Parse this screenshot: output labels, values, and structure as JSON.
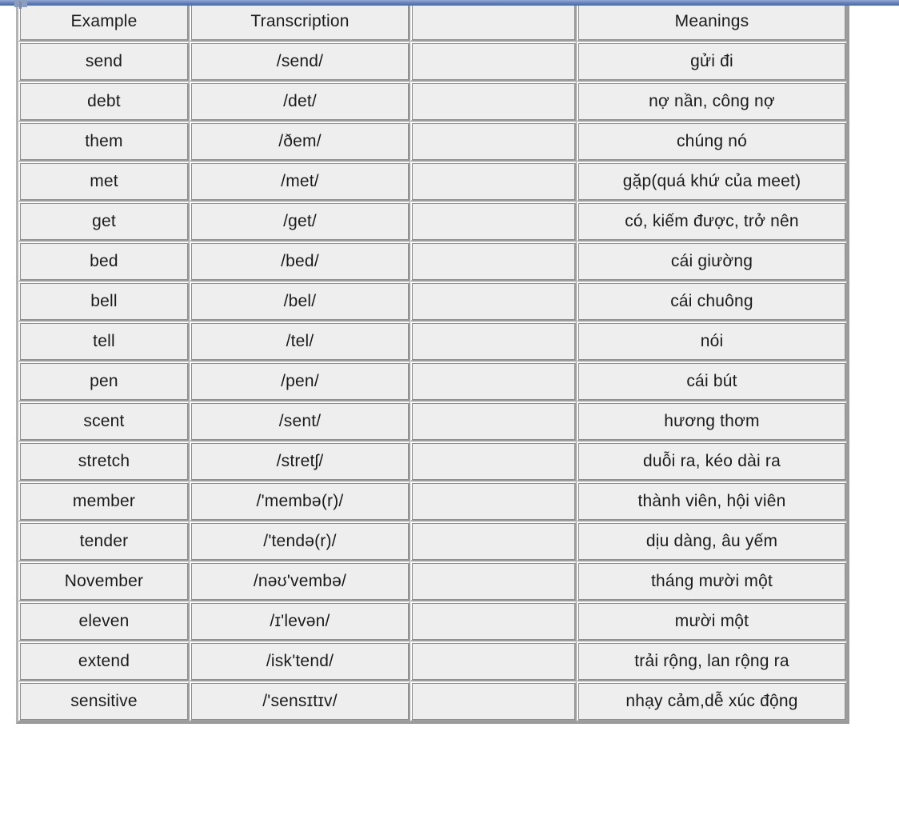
{
  "document": {
    "type": "vocabulary-table",
    "colors": {
      "transcription_text": "#1f1fa8",
      "body_text": "#1b1b1b",
      "cell_background": "#eeeeee",
      "top_strip": "#5f7cb7"
    }
  },
  "table": {
    "headers": [
      "Example",
      "Transcription",
      "",
      "Meanings"
    ],
    "rows": [
      {
        "example": "send",
        "transcription": "/send/",
        "blank": "",
        "meaning": "gửi đi"
      },
      {
        "example": "debt",
        "transcription": "/det/",
        "blank": "",
        "meaning": "nợ nần, công nợ"
      },
      {
        "example": "them",
        "transcription": "/ðem/",
        "blank": "",
        "meaning": "chúng nó"
      },
      {
        "example": "met",
        "transcription": "/met/",
        "blank": "",
        "meaning": "gặp(quá khứ của meet)"
      },
      {
        "example": "get",
        "transcription": "/get/",
        "blank": "",
        "meaning": "có, kiếm được, trở nên"
      },
      {
        "example": "bed",
        "transcription": "/bed/",
        "blank": "",
        "meaning": "cái giường"
      },
      {
        "example": "bell",
        "transcription": "/bel/",
        "blank": "",
        "meaning": "cái chuông"
      },
      {
        "example": "tell",
        "transcription": "/tel/",
        "blank": "",
        "meaning": "nói"
      },
      {
        "example": "pen",
        "transcription": "/pen/",
        "blank": "",
        "meaning": "cái bút"
      },
      {
        "example": "scent",
        "transcription": "/sent/",
        "blank": "",
        "meaning": "hương thơm"
      },
      {
        "example": "stretch",
        "transcription": "/stretʃ/",
        "blank": "",
        "meaning": "duỗi ra, kéo dài ra"
      },
      {
        "example": "member",
        "transcription": "/'membə(r)/",
        "blank": "",
        "meaning": "thành viên, hội viên"
      },
      {
        "example": "tender",
        "transcription": "/'tendə(r)/",
        "blank": "",
        "meaning": "dịu dàng, âu yếm"
      },
      {
        "example": "November",
        "transcription": "/nəʊ'vembə/",
        "blank": "",
        "meaning": "tháng mười một"
      },
      {
        "example": "eleven",
        "transcription": "/ɪ'levən/",
        "blank": "",
        "meaning": "mười một"
      },
      {
        "example": "extend",
        "transcription": "/isk'tend/",
        "blank": "",
        "meaning": "trải rộng, lan rộng ra"
      },
      {
        "example": "sensitive",
        "transcription": "/'sensɪtɪv/",
        "blank": "",
        "meaning": "nhạy cảm,dễ xúc động"
      }
    ]
  }
}
